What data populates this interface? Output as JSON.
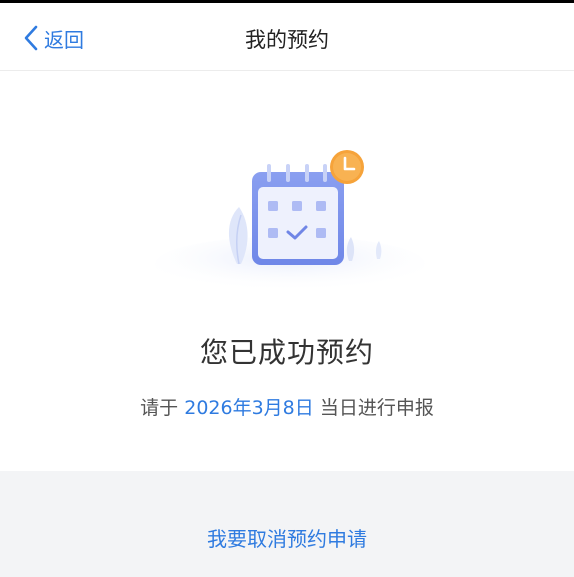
{
  "header": {
    "back_label": "返回",
    "title": "我的预约"
  },
  "main": {
    "success_title": "您已成功预约",
    "hint_prefix": "请于",
    "hint_date": "2026年3月8日",
    "hint_suffix": "当日进行申报"
  },
  "footer": {
    "cancel_label": "我要取消预约申请"
  },
  "icons": {
    "back": "chevron-left-icon",
    "calendar": "calendar-check-icon",
    "clock": "clock-icon"
  },
  "colors": {
    "accent": "#2f7be0",
    "calendar": "#7f93ec",
    "clock": "#f6a33a",
    "footer_bg": "#f3f4f6"
  }
}
